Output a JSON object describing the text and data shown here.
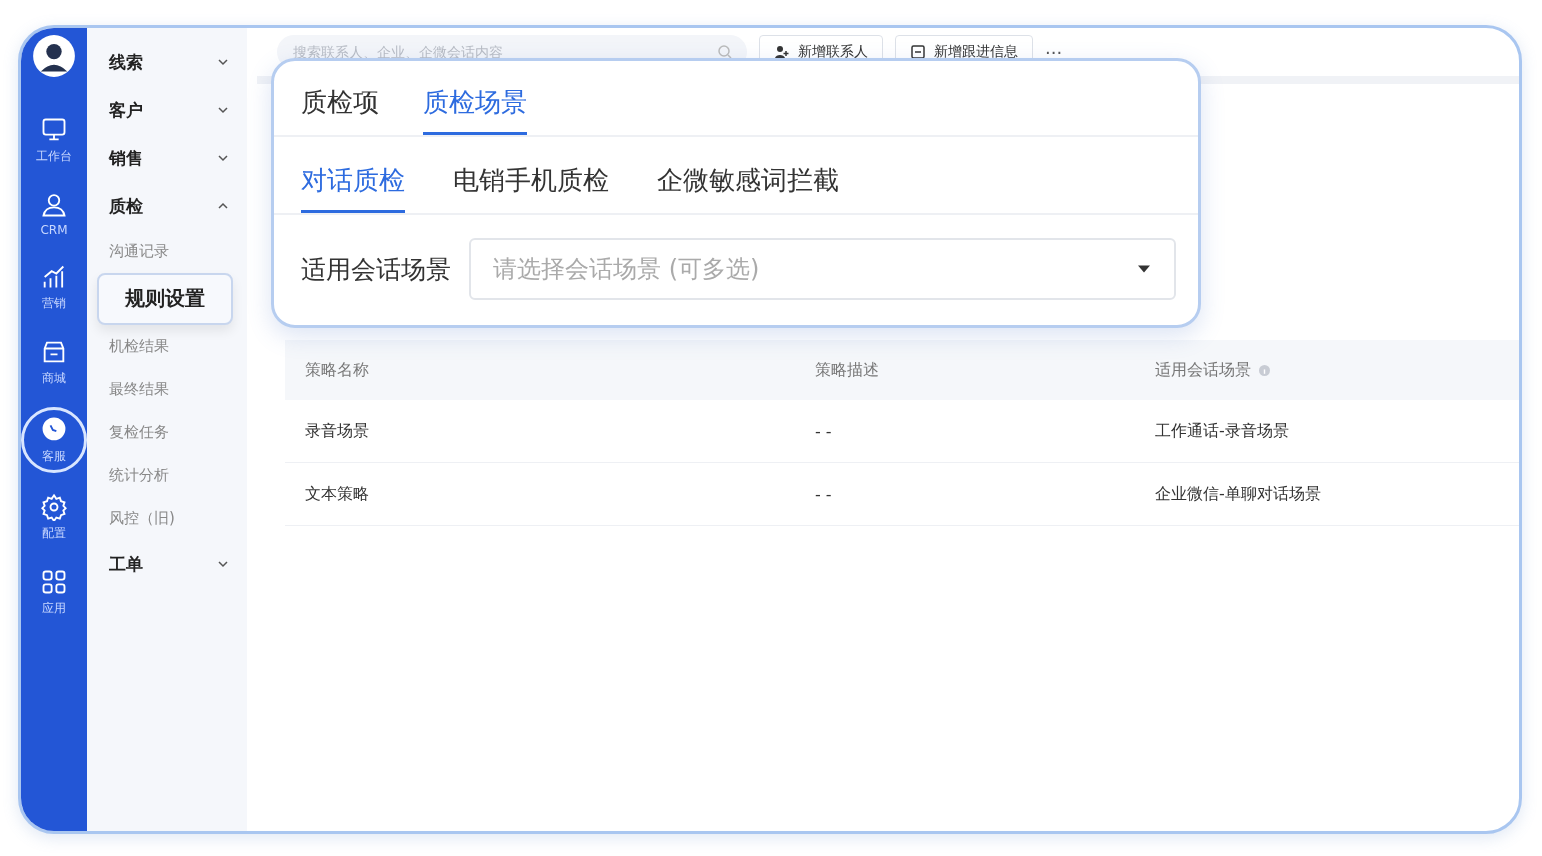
{
  "rail": [
    {
      "label": "工作台",
      "kind": "desk",
      "selected": false
    },
    {
      "label": "CRM",
      "kind": "person",
      "selected": false
    },
    {
      "label": "营销",
      "kind": "chart",
      "selected": false
    },
    {
      "label": "商城",
      "kind": "store",
      "selected": false
    },
    {
      "label": "客服",
      "kind": "chat",
      "selected": true
    },
    {
      "label": "配置",
      "kind": "gear",
      "selected": false
    },
    {
      "label": "应用",
      "kind": "apps",
      "selected": false
    }
  ],
  "search": {
    "placeholder": "搜索联系人、企业、企微会话内容"
  },
  "actions": [
    {
      "label": "新增联系人",
      "kind": "contact"
    },
    {
      "label": "新增跟进信息",
      "kind": "note"
    }
  ],
  "more": "···",
  "menu": [
    {
      "kind": "group",
      "label": "线索",
      "expanded": false
    },
    {
      "kind": "group",
      "label": "客户",
      "expanded": false
    },
    {
      "kind": "group",
      "label": "销售",
      "expanded": false
    },
    {
      "kind": "group",
      "label": "质检",
      "expanded": true
    },
    {
      "kind": "item",
      "label": "沟通记录",
      "selected": false
    },
    {
      "kind": "item",
      "label": "规则设置",
      "selected": true
    },
    {
      "kind": "item",
      "label": "机检结果",
      "selected": false
    },
    {
      "kind": "item",
      "label": "最终结果",
      "selected": false
    },
    {
      "kind": "item",
      "label": "复检任务",
      "selected": false
    },
    {
      "kind": "item",
      "label": "统计分析",
      "selected": false
    },
    {
      "kind": "item",
      "label": "风控（旧)",
      "selected": false
    },
    {
      "kind": "group",
      "label": "工单",
      "expanded": false
    }
  ],
  "popup": {
    "tabs": [
      {
        "label": "质检项",
        "selected": false
      },
      {
        "label": "质检场景",
        "selected": true
      }
    ],
    "subtabs": [
      {
        "label": "对话质检",
        "selected": true
      },
      {
        "label": "电销手机质检",
        "selected": false
      },
      {
        "label": "企微敏感词拦截",
        "selected": false
      }
    ],
    "field": {
      "label": "适用会话场景",
      "placeholder": "请选择会话场景 (可多选)"
    }
  },
  "table": {
    "columns": [
      {
        "label": "策略名称",
        "info": false
      },
      {
        "label": "策略描述",
        "info": false
      },
      {
        "label": "适用会话场景",
        "info": true
      }
    ],
    "rows": [
      [
        "录音场景",
        "- -",
        "工作通话-录音场景"
      ],
      [
        "文本策略",
        "- -",
        "企业微信-单聊对话场景"
      ]
    ]
  }
}
